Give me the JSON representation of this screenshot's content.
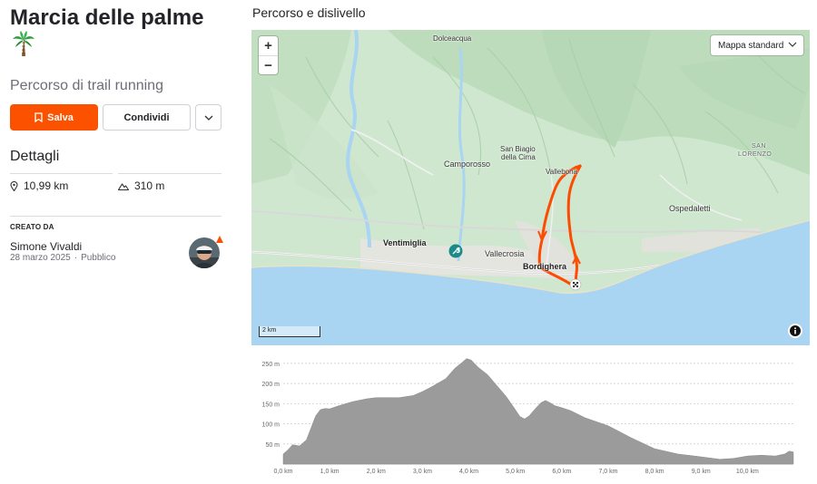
{
  "route": {
    "title": "Marcia delle palme",
    "subtitle": "Percorso di trail running"
  },
  "actions": {
    "save_label": "Salva",
    "share_label": "Condividi"
  },
  "details": {
    "heading": "Dettagli",
    "distance": "10,99 km",
    "elevation_gain": "310 m"
  },
  "creator": {
    "label": "CREATO DA",
    "name": "Simone Vivaldi",
    "date": "28 marzo 2025",
    "visibility": "Pubblico"
  },
  "map": {
    "section_title": "Percorso e dislivello",
    "zoom_in": "+",
    "zoom_out": "−",
    "map_type": "Mappa standard",
    "scale_label": "2 km",
    "places": {
      "dolceacqua": "Dolceacqua",
      "san_biagio_1": "San Biagio",
      "san_biagio_2": "della Cima",
      "camporosso": "Camporosso",
      "vallebona": "Vallebona",
      "san_lorenzo_1": "SAN",
      "san_lorenzo_2": "LORENZO",
      "ospedaletti": "Ospedaletti",
      "ventimiglia": "Ventimiglia",
      "vallecrosia": "Vallecrosia",
      "bordighera": "Bordighera"
    }
  },
  "colors": {
    "accent": "#fc5200",
    "route": "#fc4c02",
    "sea": "#a9d4f2",
    "land": "#cfe7cf",
    "profile_fill": "#9b9b9b"
  },
  "chart_data": {
    "type": "area",
    "x_unit": "km",
    "y_unit": "m",
    "x_ticks": [
      "0,0 km",
      "1,0 km",
      "2,0 km",
      "3,0 km",
      "4,0 km",
      "5,0 km",
      "6,0 km",
      "7,0 km",
      "8,0 km",
      "9,0 km",
      "10,0 km"
    ],
    "y_ticks": [
      "50 m",
      "100 m",
      "150 m",
      "200 m",
      "250 m"
    ],
    "xlim": [
      0,
      10.99
    ],
    "ylim": [
      0,
      270
    ],
    "grid": true,
    "x": [
      0,
      0.1,
      0.2,
      0.35,
      0.5,
      0.6,
      0.7,
      0.8,
      0.9,
      1.0,
      1.2,
      1.5,
      1.8,
      2.0,
      2.5,
      2.8,
      3.0,
      3.2,
      3.5,
      3.7,
      3.85,
      3.95,
      4.05,
      4.2,
      4.4,
      4.6,
      4.8,
      5.0,
      5.1,
      5.2,
      5.3,
      5.45,
      5.55,
      5.65,
      5.75,
      5.85,
      6.0,
      6.2,
      6.5,
      7.0,
      7.5,
      8.0,
      8.5,
      9.0,
      9.4,
      9.7,
      10.0,
      10.3,
      10.6,
      10.8,
      10.9,
      10.99
    ],
    "y": [
      25,
      35,
      48,
      45,
      60,
      90,
      120,
      135,
      138,
      137,
      145,
      155,
      162,
      165,
      165,
      170,
      180,
      192,
      212,
      238,
      252,
      262,
      258,
      240,
      222,
      195,
      168,
      135,
      118,
      112,
      120,
      140,
      152,
      158,
      152,
      145,
      140,
      132,
      115,
      95,
      65,
      38,
      25,
      18,
      12,
      14,
      20,
      22,
      20,
      25,
      32,
      30
    ]
  }
}
